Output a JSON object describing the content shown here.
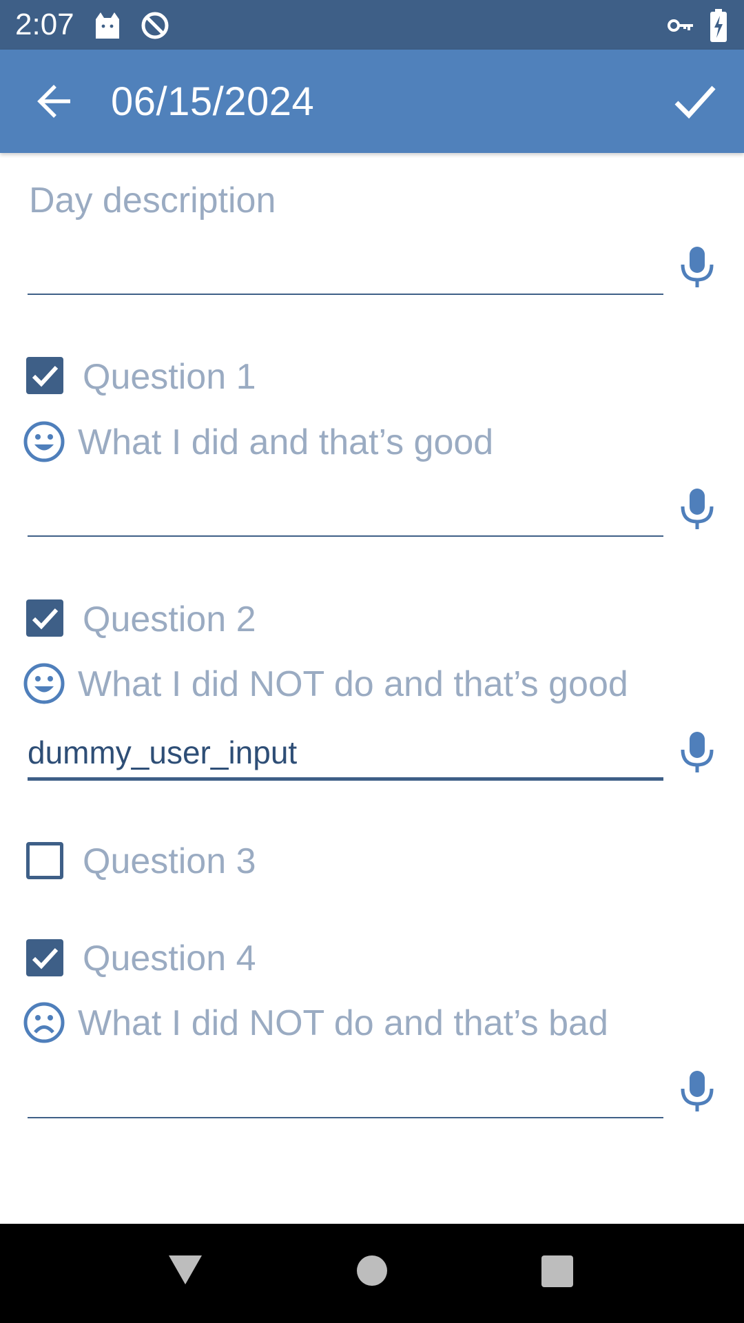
{
  "status_bar": {
    "time": "2:07",
    "icons": [
      "cat-notification-icon",
      "do-not-disturb-icon",
      "vpn-key-icon",
      "battery-charging-icon"
    ]
  },
  "app_bar": {
    "title": "06/15/2024",
    "back_icon": "arrow-back-icon",
    "confirm_icon": "check-icon"
  },
  "day_description": {
    "label": "Day description",
    "value": ""
  },
  "questions": [
    {
      "title": "Question 1",
      "checked": true,
      "mood": "happy",
      "prompt": "What I did and that’s good",
      "value": ""
    },
    {
      "title": "Question 2",
      "checked": true,
      "mood": "happy",
      "prompt": "What I did NOT do and that’s good",
      "value": "dummy_user_input"
    },
    {
      "title": "Question 3",
      "checked": false
    },
    {
      "title": "Question 4",
      "checked": true,
      "mood": "sad",
      "prompt": "What I did NOT do and that’s bad",
      "value": ""
    }
  ],
  "colors": {
    "status_bar": "#3e5f87",
    "app_bar": "#5081bb",
    "accent": "#3e5f87",
    "hint_text": "#9aabc2",
    "icon_blue": "#4f7fbb"
  }
}
